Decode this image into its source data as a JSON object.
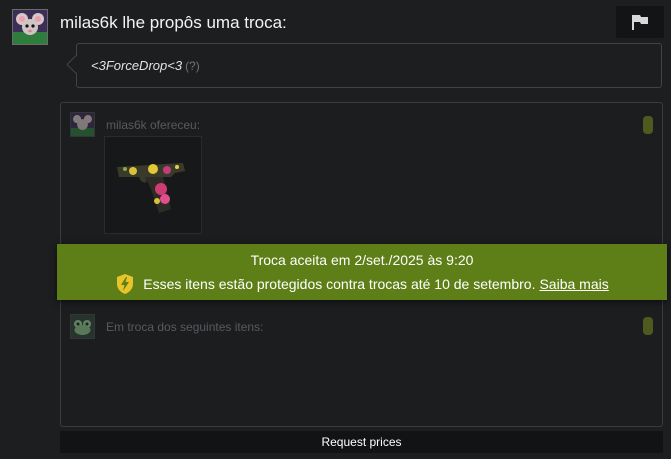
{
  "header": {
    "title": "milas6k lhe propôs uma troca:",
    "avatar_icon": "rat-hoodie-avatar-icon",
    "flag_icon": "flag-icon"
  },
  "message": {
    "text": "<3ForceDrop<3",
    "help_mark": "(?)"
  },
  "offer": {
    "label": "milas6k ofereceu:",
    "item_icon": "floral-pistol-skin-icon"
  },
  "exchange": {
    "label": "Em troca dos seguintes itens:"
  },
  "banner": {
    "line1": "Troca aceita em 2/set./2025 às 9:20",
    "line2": "Esses itens estão protegidos contra trocas até 10 de setembro.",
    "link": "Saiba mais",
    "shield_icon": "lightning-shield-icon",
    "color": "#5e7f17"
  },
  "request_prices": "Request prices"
}
